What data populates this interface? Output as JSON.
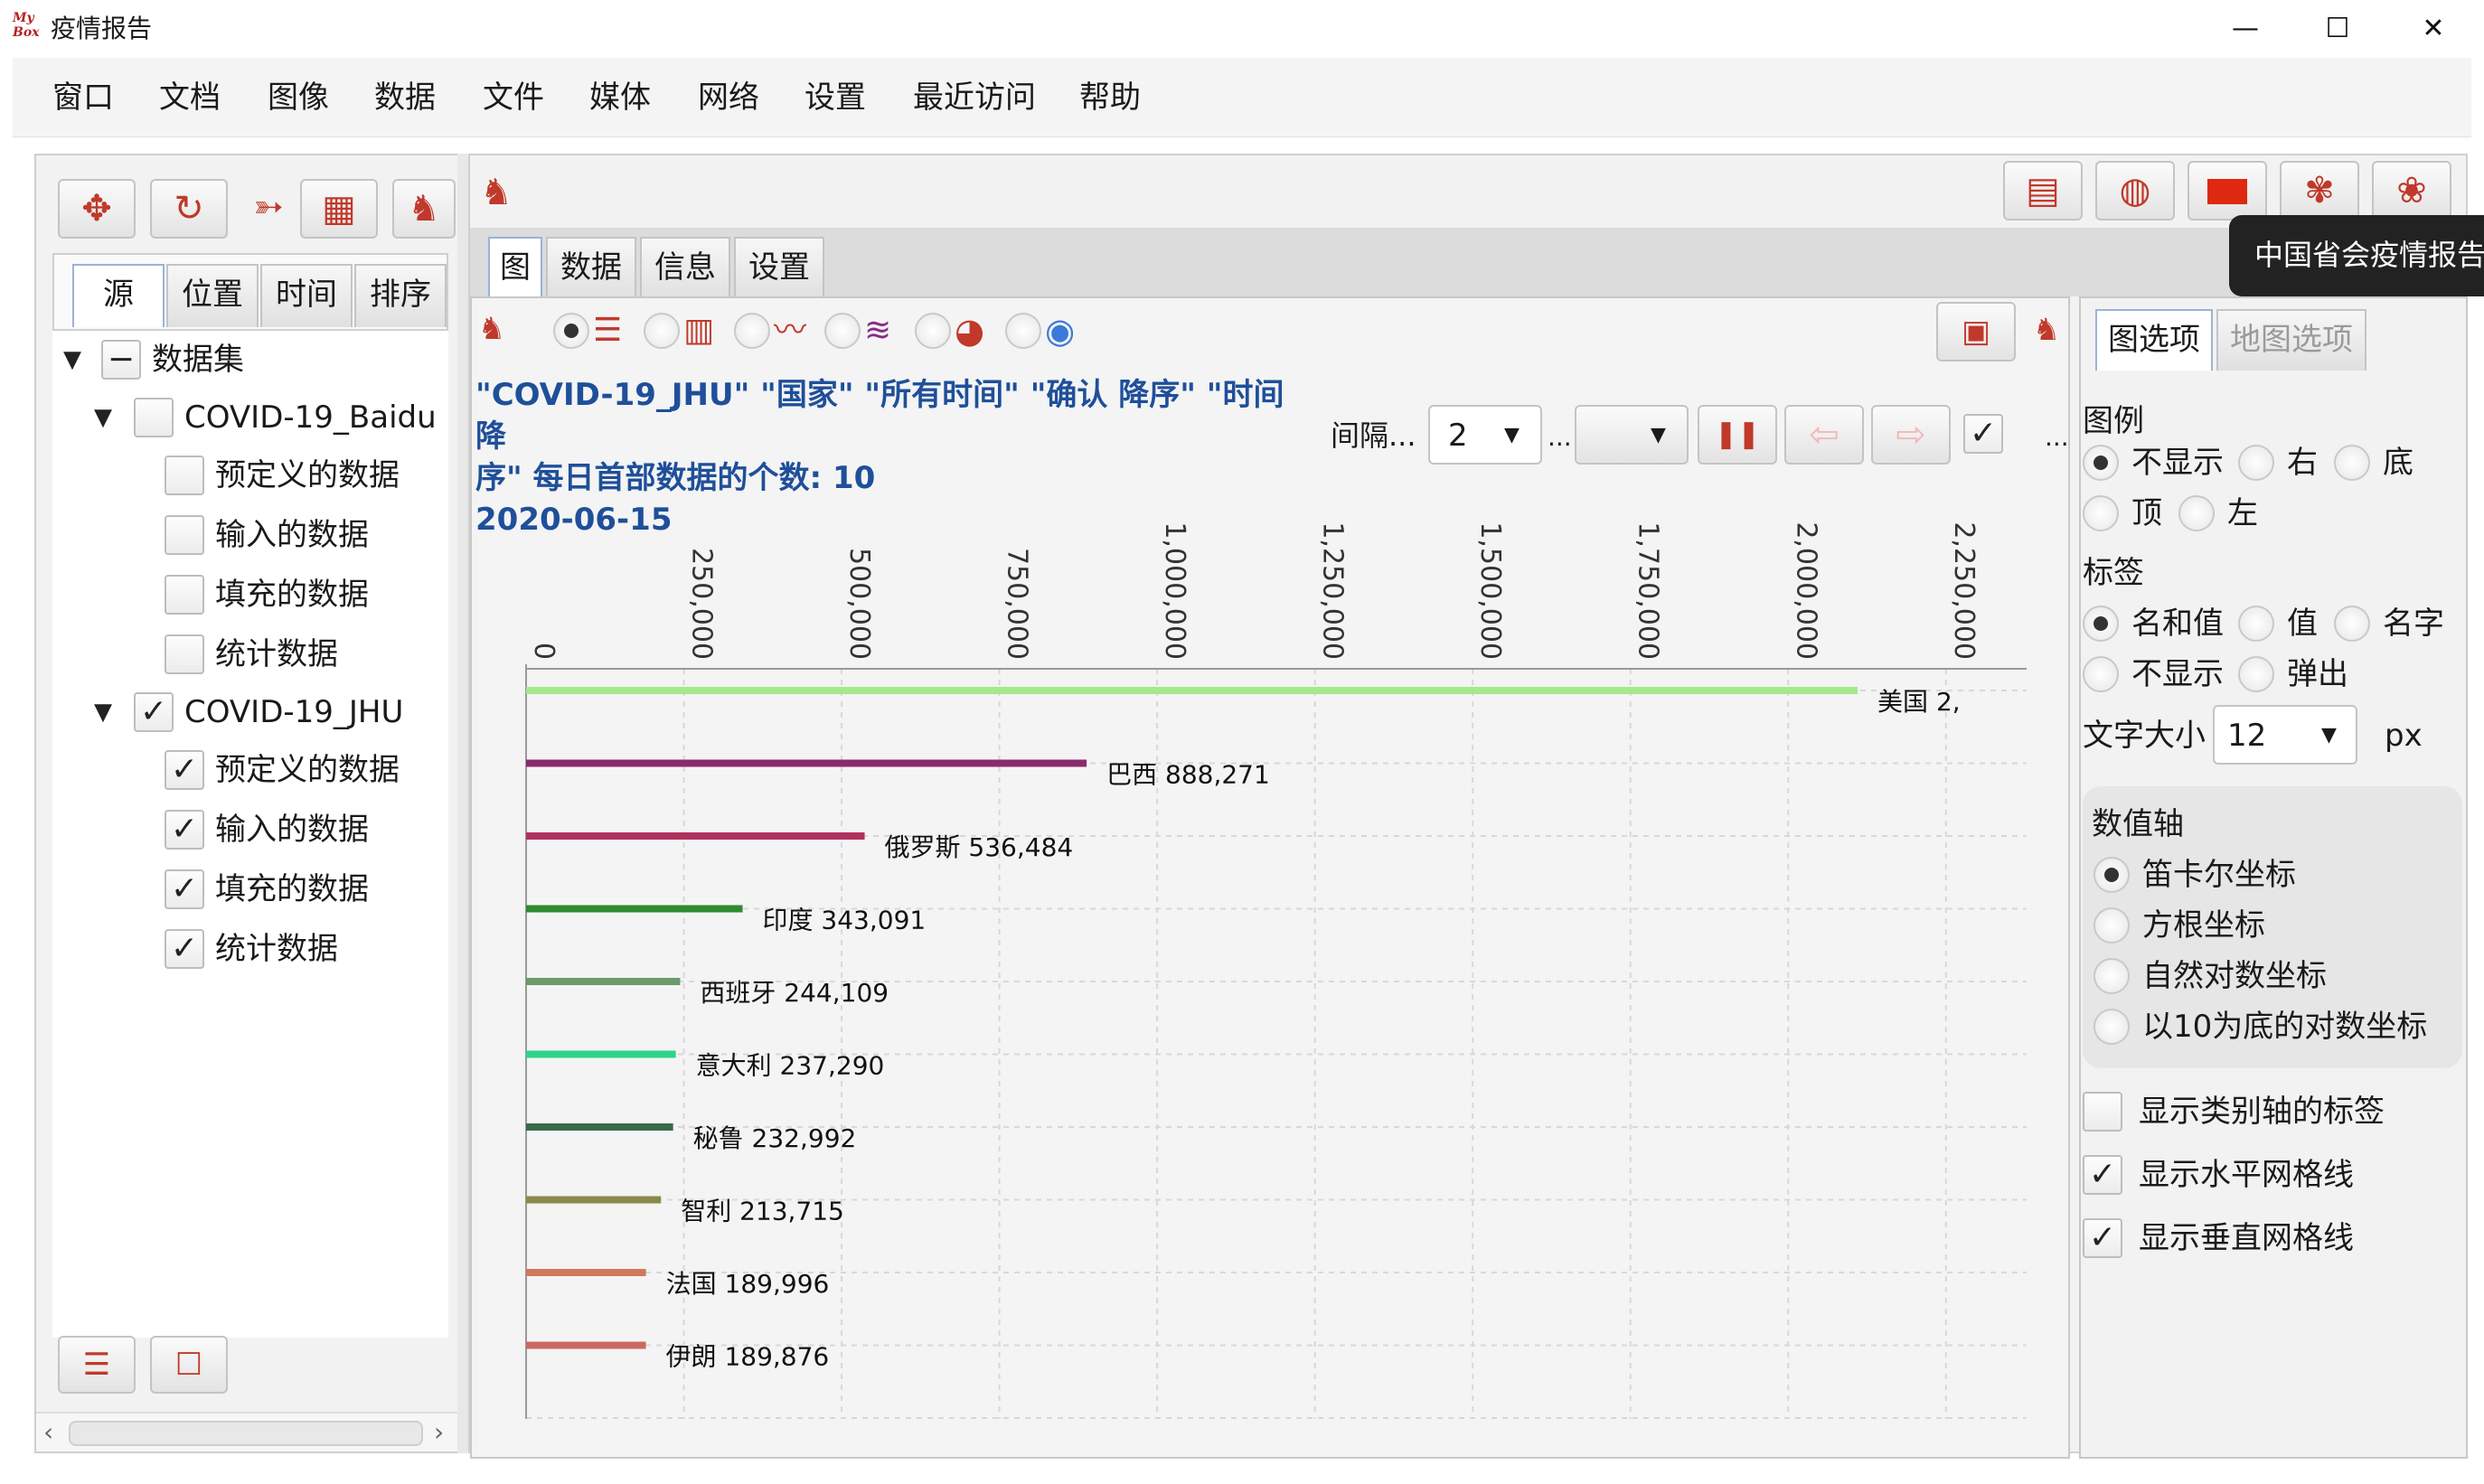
{
  "window": {
    "logo_text": "My Box",
    "title": "疫情报告",
    "minimize": "—",
    "maximize": "☐",
    "close": "✕"
  },
  "menu": [
    "窗口",
    "文档",
    "图像",
    "数据",
    "文件",
    "媒体",
    "网络",
    "设置",
    "最近访问",
    "帮助"
  ],
  "left": {
    "tabs": [
      "源",
      "位置",
      "时间",
      "排序"
    ],
    "tree": {
      "root": "数据集",
      "groups": [
        {
          "name": "COVID-19_Baidu",
          "checked": false,
          "items": [
            "预定义的数据",
            "输入的数据",
            "填充的数据",
            "统计数据"
          ],
          "items_checked": [
            false,
            false,
            false,
            false
          ]
        },
        {
          "name": "COVID-19_JHU",
          "checked": true,
          "items": [
            "预定义的数据",
            "输入的数据",
            "填充的数据",
            "统计数据"
          ],
          "items_checked": [
            true,
            true,
            true,
            true
          ]
        }
      ]
    }
  },
  "main": {
    "tabs": [
      "图",
      "数据",
      "信息",
      "设置"
    ],
    "tooltip": "中国省会疫情报告",
    "chart_title_line1": "\"COVID-19_JHU\" \"国家\" \"所有时间\" \"确认 降序\" \"时间 降",
    "chart_title_line2": "序\" 每日首部数据的个数: 10",
    "chart_title_line3": "2020-06-15",
    "interval_label": "间隔...",
    "interval_value": "2",
    "ellipsis": "..."
  },
  "right": {
    "tabs": [
      "图选项",
      "地图选项"
    ],
    "legend_title": "图例",
    "legend_options": [
      "不显示",
      "右",
      "底",
      "顶",
      "左"
    ],
    "legend_selected": "不显示",
    "label_title": "标签",
    "label_options": [
      "名和值",
      "值",
      "名字",
      "不显示",
      "弹出"
    ],
    "label_selected": "名和值",
    "font_size_label": "文字大小",
    "font_size_value": "12",
    "font_size_unit": "px",
    "axis_title": "数值轴",
    "axis_options": [
      "笛卡尔坐标",
      "方根坐标",
      "自然对数坐标",
      "以10为底的对数坐标"
    ],
    "axis_selected": "笛卡尔坐标",
    "checks": [
      {
        "label": "显示类别轴的标签",
        "checked": false
      },
      {
        "label": "显示水平网格线",
        "checked": true
      },
      {
        "label": "显示垂直网格线",
        "checked": true
      }
    ]
  },
  "chart_data": {
    "type": "bar",
    "orientation": "horizontal",
    "categories": [
      "美国",
      "巴西",
      "俄罗斯",
      "印度",
      "西班牙",
      "意大利",
      "秘鲁",
      "智利",
      "法国",
      "伊朗"
    ],
    "values": [
      2110000,
      888271,
      536484,
      343091,
      244109,
      237290,
      232992,
      213715,
      189996,
      189876
    ],
    "value_labels": [
      "美国 2,",
      "巴西 888,271",
      "俄罗斯 536,484",
      "印度 343,091",
      "西班牙 244,109",
      "意大利 237,290",
      "秘鲁 232,992",
      "智利 213,715",
      "法国 189,996",
      "伊朗 189,876"
    ],
    "colors": [
      "#a6e88e",
      "#8b2a6e",
      "#b0305e",
      "#2e8b2e",
      "#6a9a6a",
      "#2fd38a",
      "#3a6a4a",
      "#8a8a4a",
      "#d07a5a",
      "#c86a62"
    ],
    "ticks": [
      "0",
      "250,000",
      "500,000",
      "750,000",
      "1,000,000",
      "1,250,000",
      "1,500,000",
      "1,750,000",
      "2,000,000",
      "2,250,000"
    ],
    "xlim": [
      0,
      2250000
    ],
    "grid": true
  }
}
